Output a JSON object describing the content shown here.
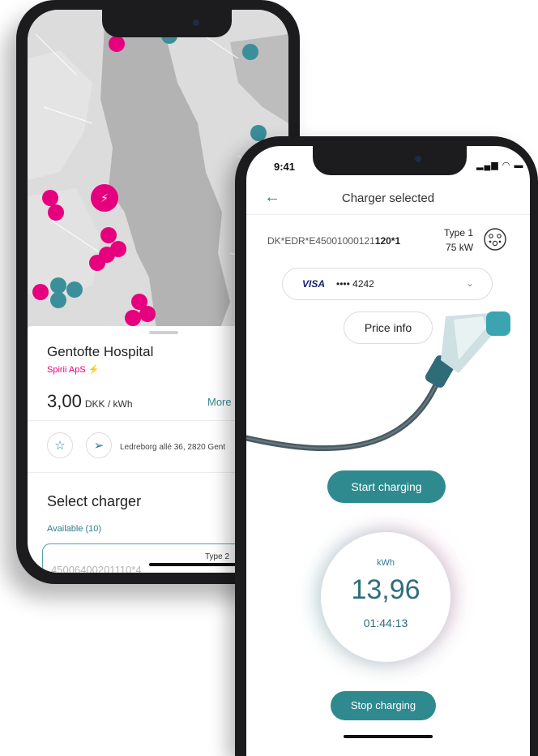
{
  "colors": {
    "accent_teal": "#2e8a8f",
    "brand_magenta": "#e6007e",
    "map_grey": "#d9d9d9"
  },
  "back_phone": {
    "location_title": "Gentofte Hospital",
    "operator": "Spirii ApS",
    "operator_icon": "lightning-icon",
    "price_value": "3,00",
    "price_unit": "DKK / kWh",
    "more_label": "More",
    "favorite_icon": "star-icon",
    "navigate_icon": "navigate-icon",
    "address": "Ledreborg allé 36, 2820 Gent",
    "select_charger": "Select charger",
    "available": "Available (10)",
    "charger_id": "45006400201110*4",
    "charger_type": "Type 2"
  },
  "front_phone": {
    "status_time": "9:41",
    "header_title": "Charger selected",
    "evse_prefix": "DK*EDR*E45001000121",
    "evse_suffix": "120*1",
    "connector_type": "Type 1",
    "connector_power": "75 kW",
    "payment_brand": "VISA",
    "payment_card": "•••• 4242",
    "price_info_label": "Price info",
    "start_label": "Start charging",
    "meter_unit": "kWh",
    "meter_value": "13,96",
    "meter_time": "01:44:13",
    "stop_label": "Stop charging"
  }
}
